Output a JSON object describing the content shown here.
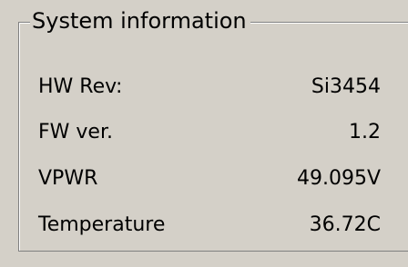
{
  "group": {
    "title": "System information"
  },
  "rows": [
    {
      "label": "HW Rev:",
      "value": "Si3454"
    },
    {
      "label": "FW ver.",
      "value": "1.2"
    },
    {
      "label": "VPWR",
      "value": "49.095V"
    },
    {
      "label": "Temperature",
      "value": "36.72C"
    }
  ]
}
